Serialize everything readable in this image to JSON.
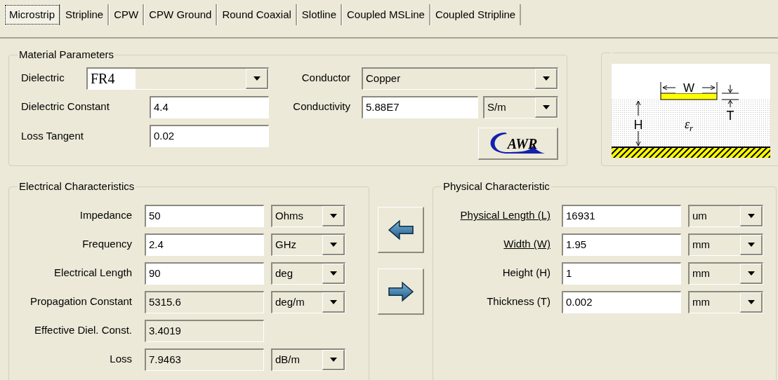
{
  "tabs": [
    {
      "label": "Microstrip",
      "selected": true
    },
    {
      "label": "Stripline",
      "selected": false
    },
    {
      "label": "CPW",
      "selected": false
    },
    {
      "label": "CPW Ground",
      "selected": false
    },
    {
      "label": "Round Coaxial",
      "selected": false
    },
    {
      "label": "Slotline",
      "selected": false
    },
    {
      "label": "Coupled MSLine",
      "selected": false
    },
    {
      "label": "Coupled Stripline",
      "selected": false
    }
  ],
  "material": {
    "title": "Material Parameters",
    "dielectric": {
      "label": "Dielectric",
      "value": "FR4"
    },
    "dielectric_constant": {
      "label": "Dielectric Constant",
      "value": "4.4"
    },
    "loss_tangent": {
      "label": "Loss Tangent",
      "value": "0.02"
    },
    "conductor": {
      "label": "Conductor",
      "value": "Copper"
    },
    "conductivity": {
      "label": "Conductivity",
      "value": "5.88E7",
      "unit": "S/m"
    },
    "logo": "AWR"
  },
  "diagram": {
    "width_label": "W",
    "height_label": "H",
    "thickness_label": "T",
    "permittivity_label": "ε",
    "permittivity_subscript": "r"
  },
  "electrical": {
    "title": "Electrical Characteristics",
    "rows": [
      {
        "label": "Impedance",
        "value": "50",
        "unit": "Ohms",
        "readonly": false
      },
      {
        "label": "Frequency",
        "value": "2.4",
        "unit": "GHz",
        "readonly": false
      },
      {
        "label": "Electrical Length",
        "value": "90",
        "unit": "deg",
        "readonly": false
      },
      {
        "label": "Propagation Constant",
        "value": "5315.6",
        "unit": "deg/m",
        "readonly": true
      },
      {
        "label": "Effective Diel. Const.",
        "value": "3.4019",
        "readonly": true
      },
      {
        "label": "Loss",
        "value": "7.9463",
        "unit": "dB/m",
        "readonly": true
      }
    ]
  },
  "physical": {
    "title": "Physical Characteristic",
    "rows": [
      {
        "label": "Physical Length (L)",
        "value": "16931",
        "unit": "um",
        "underlined": true
      },
      {
        "label": "Width (W)",
        "value": "1.95",
        "unit": "mm",
        "underlined": true
      },
      {
        "label": "Height (H)",
        "value": "1",
        "unit": "mm",
        "underlined": false
      },
      {
        "label": "Thickness (T)",
        "value": "0.002",
        "unit": "mm",
        "underlined": false
      }
    ]
  }
}
